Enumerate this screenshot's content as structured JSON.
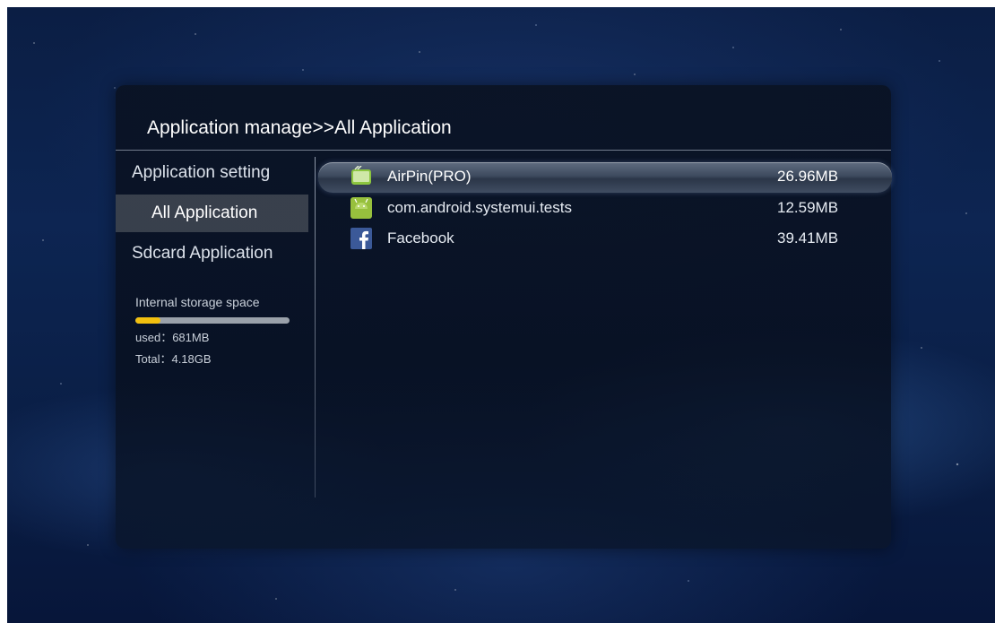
{
  "header": {
    "title": "Application manage>>All Application"
  },
  "sidebar": {
    "items": [
      {
        "label": "Application setting",
        "active": false
      },
      {
        "label": "All Application",
        "active": true
      },
      {
        "label": "Sdcard Application",
        "active": false
      }
    ]
  },
  "storage": {
    "label": "Internal storage space",
    "used": "used：681MB",
    "total": "Total：4.18GB",
    "used_fraction": 0.16,
    "bar_fill_color": "#f2c00f"
  },
  "apps": [
    {
      "name": "AirPin(PRO)",
      "size": "26.96MB",
      "icon": "airpin-icon",
      "selected": true
    },
    {
      "name": "com.android.systemui.tests",
      "size": "12.59MB",
      "icon": "android-icon",
      "selected": false
    },
    {
      "name": "Facebook",
      "size": "39.41MB",
      "icon": "facebook-icon",
      "selected": false
    }
  ],
  "colors": {
    "android_green": "#97c03d",
    "facebook_blue": "#3b5998",
    "airpin_green": "#8cc63f"
  }
}
